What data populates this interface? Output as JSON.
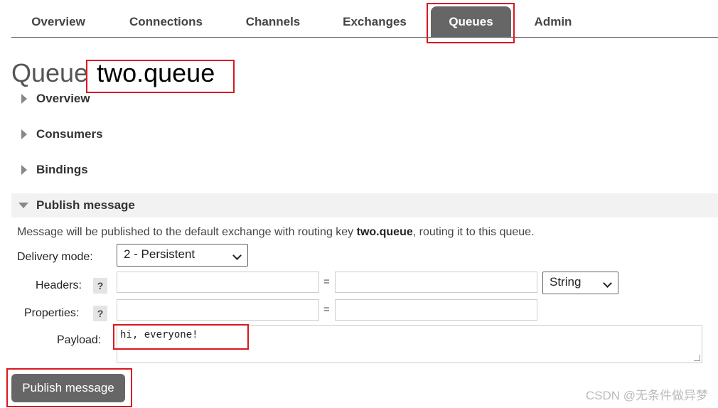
{
  "nav": {
    "tabs": [
      {
        "label": "Overview"
      },
      {
        "label": "Connections"
      },
      {
        "label": "Channels"
      },
      {
        "label": "Exchanges"
      },
      {
        "label": "Queues"
      },
      {
        "label": "Admin"
      }
    ],
    "active_tab": "Queues"
  },
  "page": {
    "title_prefix": "Queue",
    "queue_name": "two.queue"
  },
  "sections": [
    {
      "label": "Overview",
      "expanded": false
    },
    {
      "label": "Consumers",
      "expanded": false
    },
    {
      "label": "Bindings",
      "expanded": false
    },
    {
      "label": "Publish message",
      "expanded": true
    }
  ],
  "publish": {
    "description_before": "Message will be published to the default exchange with routing key ",
    "routing_key": "two.queue",
    "description_after": ", routing it to this queue.",
    "delivery_mode_label": "Delivery mode:",
    "delivery_mode_value": "2 - Persistent",
    "headers_label": "Headers:",
    "properties_label": "Properties:",
    "help_glyph": "?",
    "equals": "=",
    "header_type_value": "String",
    "payload_label": "Payload:",
    "payload_value": "hi, everyone!",
    "button_label": "Publish message"
  },
  "watermark": "CSDN @无条件做异梦",
  "colors": {
    "highlight": "#d9181f",
    "tab_active": "#666666",
    "button": "#666666"
  }
}
